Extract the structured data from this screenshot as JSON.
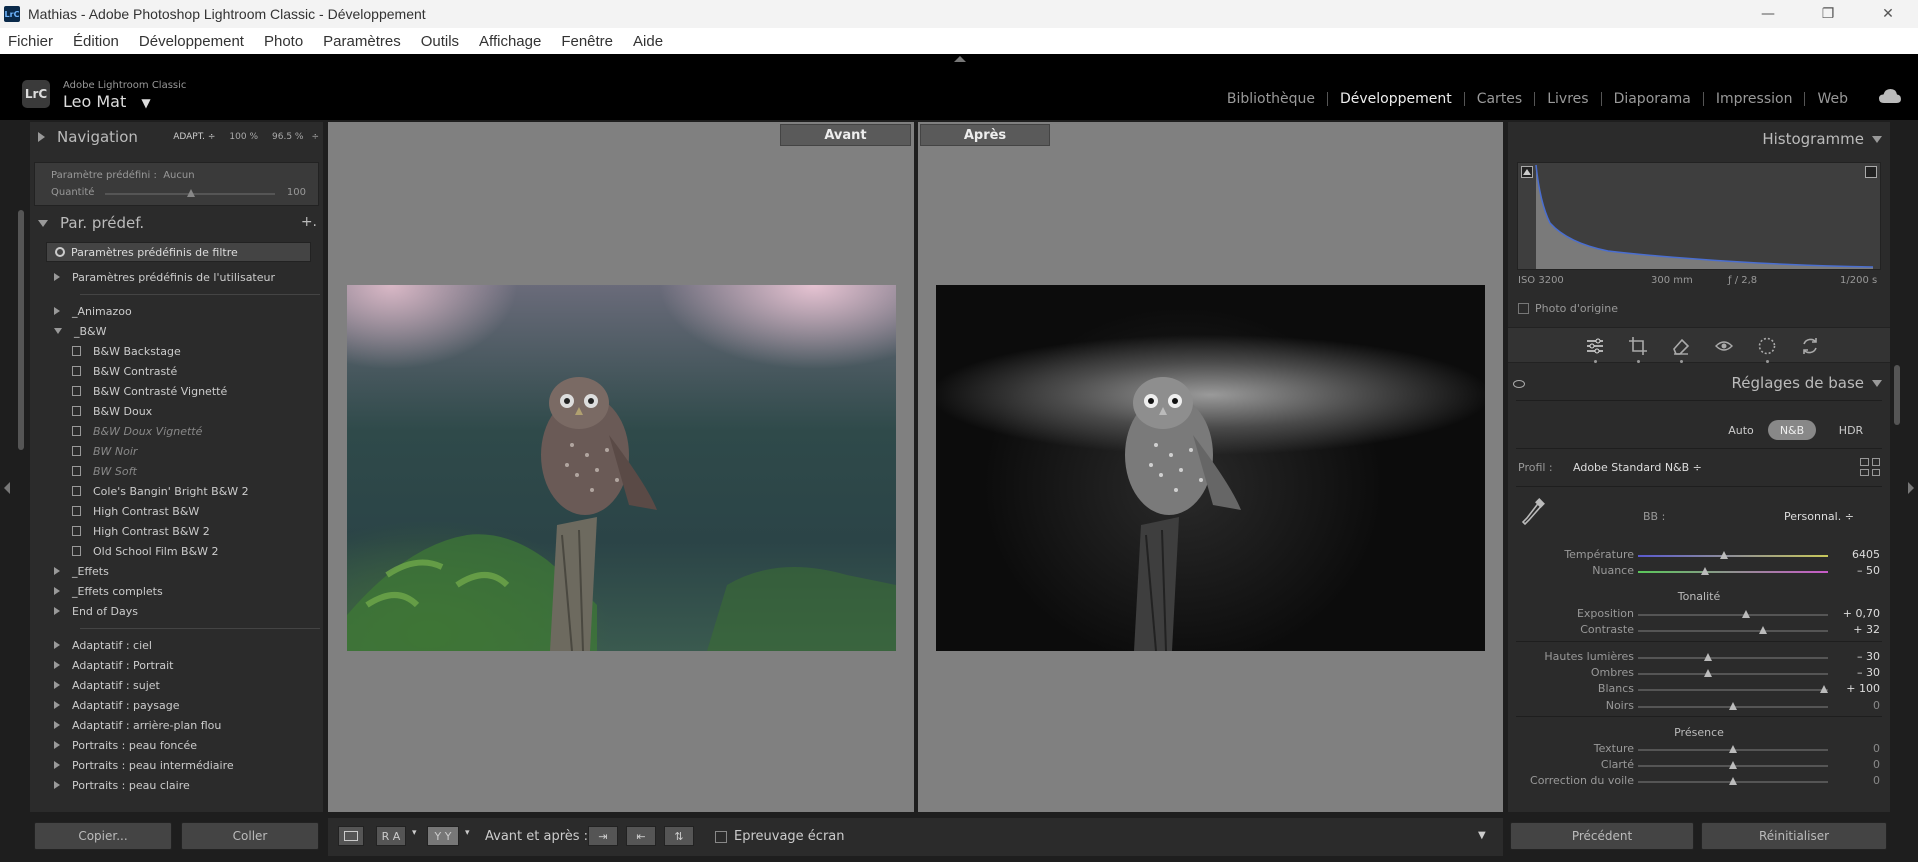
{
  "window": {
    "title": "Mathias - Adobe Photoshop Lightroom Classic - Développement",
    "app_badge": "LrC"
  },
  "menu": [
    "Fichier",
    "Édition",
    "Développement",
    "Photo",
    "Paramètres",
    "Outils",
    "Affichage",
    "Fenêtre",
    "Aide"
  ],
  "header": {
    "logo": "LrC",
    "product": "Adobe Lightroom Classic",
    "catalog": "Leo Mat",
    "modules": [
      "Bibliothèque",
      "Développement",
      "Cartes",
      "Livres",
      "Diaporama",
      "Impression",
      "Web"
    ],
    "active_module": "Développement"
  },
  "left": {
    "navigation": {
      "title": "Navigation",
      "zoom": [
        "ADAPT. ÷",
        "100 %",
        "96.5 %",
        "÷"
      ]
    },
    "preset_box": {
      "label": "Paramètre prédéfini :",
      "value": "Aucun",
      "amount_label": "Quantité",
      "amount_value": "100"
    },
    "presets": {
      "title": "Par. prédef.",
      "add": "+.",
      "filter": "Paramètres prédéfinis de filtre",
      "items": [
        {
          "type": "group",
          "label": "Paramètres prédéfinis de l'utilisateur",
          "open": false
        },
        {
          "type": "sep"
        },
        {
          "type": "group",
          "label": "_Animazoo",
          "open": false
        },
        {
          "type": "group",
          "label": "_B&W",
          "open": true
        },
        {
          "type": "preset",
          "label": "B&W Backstage"
        },
        {
          "type": "preset",
          "label": "B&W Contrasté"
        },
        {
          "type": "preset",
          "label": "B&W Contrasté Vignetté"
        },
        {
          "type": "preset",
          "label": "B&W Doux"
        },
        {
          "type": "preset",
          "label": "B&W Doux Vignetté",
          "dim": true
        },
        {
          "type": "preset",
          "label": "BW Noir",
          "dim": true
        },
        {
          "type": "preset",
          "label": "BW Soft",
          "dim": true
        },
        {
          "type": "preset",
          "label": "Cole's Bangin' Bright B&W 2"
        },
        {
          "type": "preset",
          "label": "High Contrast B&W"
        },
        {
          "type": "preset",
          "label": "High Contrast B&W 2"
        },
        {
          "type": "preset",
          "label": "Old School Film B&W 2"
        },
        {
          "type": "group",
          "label": "_Effets",
          "open": false
        },
        {
          "type": "group",
          "label": "_Effets complets",
          "open": false
        },
        {
          "type": "group",
          "label": "End of Days",
          "open": false
        },
        {
          "type": "sep"
        },
        {
          "type": "group",
          "label": "Adaptatif : ciel",
          "open": false
        },
        {
          "type": "group",
          "label": "Adaptatif : Portrait",
          "open": false
        },
        {
          "type": "group",
          "label": "Adaptatif : sujet",
          "open": false
        },
        {
          "type": "group",
          "label": "Adaptatif : paysage",
          "open": false
        },
        {
          "type": "group",
          "label": "Adaptatif : arrière-plan flou",
          "open": false
        },
        {
          "type": "group",
          "label": "Portraits : peau foncée",
          "open": false
        },
        {
          "type": "group",
          "label": "Portraits : peau intermédiaire",
          "open": false
        },
        {
          "type": "group",
          "label": "Portraits : peau claire",
          "open": false
        }
      ]
    },
    "buttons": {
      "copy": "Copier...",
      "paste": "Coller"
    }
  },
  "center": {
    "before_label": "Avant",
    "after_label": "Après",
    "toolbar": {
      "view_ra": "R A",
      "view_yy": "Y Y",
      "before_after_label": "Avant et après :",
      "softproof_label": "Epreuvage écran"
    }
  },
  "right": {
    "histogram": {
      "title": "Histogramme",
      "iso": "ISO 3200",
      "focal": "300 mm",
      "aperture": "ƒ / 2,8",
      "shutter": "1/200 s",
      "original_photo": "Photo d'origine"
    },
    "basic": {
      "title": "Réglages de base",
      "treatment": [
        "Auto",
        "N&B",
        "HDR"
      ],
      "treatment_selected": "N&B",
      "profile_label": "Profil :",
      "profile_value": "Adobe Standard N&B ÷",
      "wb_label": "BB :",
      "wb_value": "Personnal. ÷",
      "temperature": {
        "label": "Température",
        "value": "6405",
        "pos": 0.45
      },
      "tint": {
        "label": "Nuance",
        "value": "– 50",
        "pos": 0.35
      },
      "tone_title": "Tonalité",
      "exposure": {
        "label": "Exposition",
        "value": "+ 0,70",
        "pos": 0.57
      },
      "contrast": {
        "label": "Contraste",
        "value": "+ 32",
        "pos": 0.66
      },
      "highlights": {
        "label": "Hautes lumières",
        "value": "– 30",
        "pos": 0.37
      },
      "shadows": {
        "label": "Ombres",
        "value": "– 30",
        "pos": 0.37
      },
      "whites": {
        "label": "Blancs",
        "value": "+ 100",
        "pos": 0.98
      },
      "blacks": {
        "label": "Noirs",
        "value": "0",
        "pos": 0.5
      },
      "presence_title": "Présence",
      "texture": {
        "label": "Texture",
        "value": "0",
        "pos": 0.5
      },
      "clarity": {
        "label": "Clarté",
        "value": "0",
        "pos": 0.5
      },
      "dehaze": {
        "label": "Correction du voile",
        "value": "0",
        "pos": 0.5
      }
    },
    "buttons": {
      "previous": "Précédent",
      "reset": "Réinitialiser"
    }
  }
}
